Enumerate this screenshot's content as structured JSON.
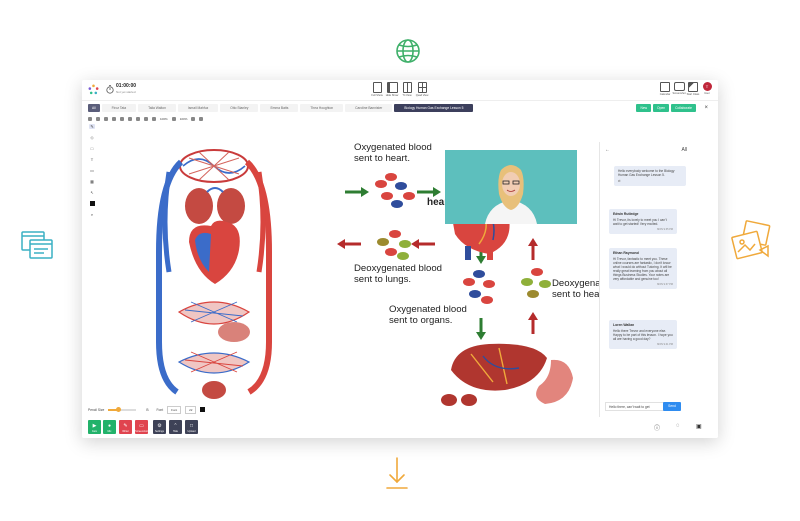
{
  "header": {
    "timer": "01:00:00",
    "subtitle": "Not yet started",
    "center_tools": [
      {
        "label": "Full Show"
      },
      {
        "label": "Hide Show"
      },
      {
        "label": "Tri View"
      },
      {
        "label": "Quad View"
      }
    ],
    "right_tools": [
      {
        "label": "Calendar"
      },
      {
        "label": "Screenshot"
      },
      {
        "label": "Start Class"
      }
    ],
    "user_initial": "T",
    "user_label": "User"
  },
  "tabs": {
    "all_label": "All",
    "items": [
      "Firoz Tata",
      "Talia Walton",
      "Ismail Mahfuz",
      "Otto Stanley",
      "Emma Batts",
      "Thea Houghton",
      "Caroline Bannister"
    ],
    "active": "Biology Human Gas Exchange Lesson 5"
  },
  "tab_actions": {
    "new": "New",
    "open": "Open",
    "collaborate": "Collaborate",
    "close": "×"
  },
  "toolbar2": {
    "zoom": "100%",
    "zoom_alt": "100%"
  },
  "board": {
    "label_top": "Oxygenated blood\nsent to heart.",
    "label_deoxy_left": "Deoxygenated blood\nsent to lungs.",
    "label_organs": "Oxygenated blood\nsent to organs.",
    "label_deoxy_right": "Deoxygenated blood\nsent to heart.",
    "heart_label": "heart"
  },
  "chat": {
    "filter": "All",
    "messages": [
      {
        "name": "",
        "text": "Hello everybody welcome to the Biology Human Gas Exchange Lesson 5.",
        "time": ""
      },
      {
        "name": "Edwin Rutledge",
        "text": "Hi Trevor, its lovely to meet you I can't wait to get started! Very excited.",
        "time": "MON 9:35 PM"
      },
      {
        "name": "Ethan Raymond",
        "text": "Hi Trevor, fantastic to meet you. These online courses are fantastic, I don't know what I would do without Tutoring. It will be really great learning from you about all things Business Studies. Your notes are very affordable and genuine too!",
        "time": "MON 9:37 PM"
      },
      {
        "name": "Loren Wallan",
        "text": "Hello there Trevor and everyone else. Happy to be part of this lesson. I hope you all are having a good day?",
        "time": "MON 9:41 PM"
      }
    ],
    "input_value": "Hello there, can't wait to get",
    "send_label": "Send"
  },
  "penbar": {
    "pen_size_label": "Pencil Size",
    "pen_size_value": 0.35,
    "font_label": "Font",
    "font_value": "Font",
    "size_value": "22"
  },
  "bottom": {
    "buttons": [
      {
        "label": "Cam",
        "color": "#22b26a"
      },
      {
        "label": "Mic",
        "color": "#22b26a"
      },
      {
        "label": "Writer",
        "color": "#e0444f"
      },
      {
        "label": "Screenshot",
        "color": "#e0444f"
      },
      {
        "label": "Settings",
        "color": "#3e4257"
      },
      {
        "label": "Hide",
        "color": "#3e4257"
      },
      {
        "label": "Upload",
        "color": "#3e4257"
      }
    ]
  },
  "colors": {
    "accent_green": "#2fc18c",
    "dark_tab": "#3c3f5c",
    "chat_bubble": "#e7ecf6",
    "send_blue": "#2f8cf0"
  }
}
